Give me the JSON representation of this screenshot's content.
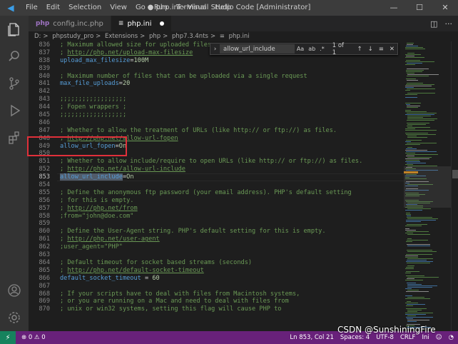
{
  "titlebar": {
    "menu": [
      "File",
      "Edit",
      "Selection",
      "View",
      "Go",
      "Run",
      "Terminal",
      "Help"
    ],
    "window_title": "● php.ini - Visual Studio Code [Administrator]",
    "controls": [
      "—",
      "☐",
      "✕"
    ]
  },
  "activity_icons": [
    "files-icon",
    "search-icon",
    "source-control-icon",
    "run-debug-icon",
    "extensions-icon",
    "account-icon",
    "manage-gear-icon"
  ],
  "tabs": [
    {
      "label": "config.inc.php",
      "icon": "php-icon",
      "color": "#a074c4",
      "active": false
    },
    {
      "label": "php.ini",
      "icon": "ini-icon",
      "color": "#cccccc",
      "active": true,
      "modified": true
    }
  ],
  "breadcrumb": [
    "D:",
    "phpstudy_pro",
    "Extensions",
    "php",
    "php7.3.4nts",
    "php.ini"
  ],
  "find": {
    "query": "allow_url_include",
    "options": [
      "Aa",
      "ab",
      ".*"
    ],
    "count": "1 of 1"
  },
  "lines": [
    {
      "n": "836",
      "parts": [
        [
          "c",
          "; Maximum allowed size for uploaded files."
        ]
      ]
    },
    {
      "n": "837",
      "parts": [
        [
          "c",
          "; "
        ],
        [
          "u",
          "http://php.net/upload-max-filesize"
        ]
      ]
    },
    {
      "n": "838",
      "parts": [
        [
          "k",
          "upload_max_filesize"
        ],
        [
          "op",
          "="
        ],
        [
          "v",
          "100M"
        ]
      ]
    },
    {
      "n": "839",
      "parts": []
    },
    {
      "n": "840",
      "parts": [
        [
          "c",
          "; Maximum number of files that can be uploaded via a single request"
        ]
      ]
    },
    {
      "n": "841",
      "parts": [
        [
          "k",
          "max_file_uploads"
        ],
        [
          "op",
          "="
        ],
        [
          "v",
          "20"
        ]
      ]
    },
    {
      "n": "842",
      "parts": []
    },
    {
      "n": "843",
      "parts": [
        [
          "c",
          ";;;;;;;;;;;;;;;;;;"
        ]
      ]
    },
    {
      "n": "844",
      "parts": [
        [
          "c",
          "; Fopen wrappers ;"
        ]
      ]
    },
    {
      "n": "845",
      "parts": [
        [
          "c",
          ";;;;;;;;;;;;;;;;;;"
        ]
      ]
    },
    {
      "n": "846",
      "parts": []
    },
    {
      "n": "847",
      "parts": [
        [
          "c",
          "; Whether to allow the treatment of URLs (like http:// or ftp://) as files."
        ]
      ]
    },
    {
      "n": "848",
      "parts": [
        [
          "c",
          "; "
        ],
        [
          "u",
          "http://php.net/allow-url-fopen"
        ]
      ]
    },
    {
      "n": "849",
      "parts": [
        [
          "k",
          "allow_url_fopen"
        ],
        [
          "op",
          "="
        ],
        [
          "v",
          "On"
        ]
      ]
    },
    {
      "n": "850",
      "parts": []
    },
    {
      "n": "851",
      "parts": [
        [
          "c",
          "; Whether to allow include/require to open URLs (like http:// or ftp://) as files."
        ]
      ]
    },
    {
      "n": "852",
      "parts": [
        [
          "c",
          "; "
        ],
        [
          "u",
          "http://php.net/allow-url-include"
        ]
      ]
    },
    {
      "n": "853",
      "parts": [
        [
          "hl",
          "allow_url_include"
        ],
        [
          "op",
          "="
        ],
        [
          "v",
          "On"
        ]
      ],
      "current": true
    },
    {
      "n": "854",
      "parts": []
    },
    {
      "n": "855",
      "parts": [
        [
          "c",
          "; Define the anonymous ftp password (your email address). PHP's default setting"
        ]
      ]
    },
    {
      "n": "856",
      "parts": [
        [
          "c",
          "; for this is empty."
        ]
      ]
    },
    {
      "n": "857",
      "parts": [
        [
          "c",
          "; "
        ],
        [
          "u",
          "http://php.net/from"
        ]
      ]
    },
    {
      "n": "858",
      "parts": [
        [
          "c",
          ";from=\"john@doe.com\""
        ]
      ]
    },
    {
      "n": "859",
      "parts": []
    },
    {
      "n": "860",
      "parts": [
        [
          "c",
          "; Define the User-Agent string. PHP's default setting for this is empty."
        ]
      ]
    },
    {
      "n": "861",
      "parts": [
        [
          "c",
          "; "
        ],
        [
          "u",
          "http://php.net/user-agent"
        ]
      ]
    },
    {
      "n": "862",
      "parts": [
        [
          "c",
          ";user_agent=\"PHP\""
        ]
      ]
    },
    {
      "n": "863",
      "parts": []
    },
    {
      "n": "864",
      "parts": [
        [
          "c",
          "; Default timeout for socket based streams (seconds)"
        ]
      ]
    },
    {
      "n": "865",
      "parts": [
        [
          "c",
          "; "
        ],
        [
          "u",
          "http://php.net/default-socket-timeout"
        ]
      ]
    },
    {
      "n": "866",
      "parts": [
        [
          "k",
          "default_socket_timeout"
        ],
        [
          "op",
          " = "
        ],
        [
          "v",
          "60"
        ]
      ]
    },
    {
      "n": "867",
      "parts": []
    },
    {
      "n": "868",
      "parts": [
        [
          "c",
          "; If your scripts have to deal with files from Macintosh systems,"
        ]
      ]
    },
    {
      "n": "869",
      "parts": [
        [
          "c",
          "; or you are running on a Mac and need to deal with files from"
        ]
      ]
    },
    {
      "n": "870",
      "parts": [
        [
          "c",
          "; unix or win32 systems, setting this flag will cause PHP to"
        ]
      ]
    }
  ],
  "statusbar": {
    "problems": "⊗ 0 ⚠ 0",
    "right": [
      "Ln 853, Col 21",
      "Spaces: 4",
      "UTF-8",
      "CRLF",
      "Ini"
    ]
  },
  "watermark": "CSDN @SunshiningFire",
  "colors": {
    "statusbar": "#68217a",
    "highlight_box": "#e0303a",
    "editor_bg": "#1e1e1e"
  }
}
